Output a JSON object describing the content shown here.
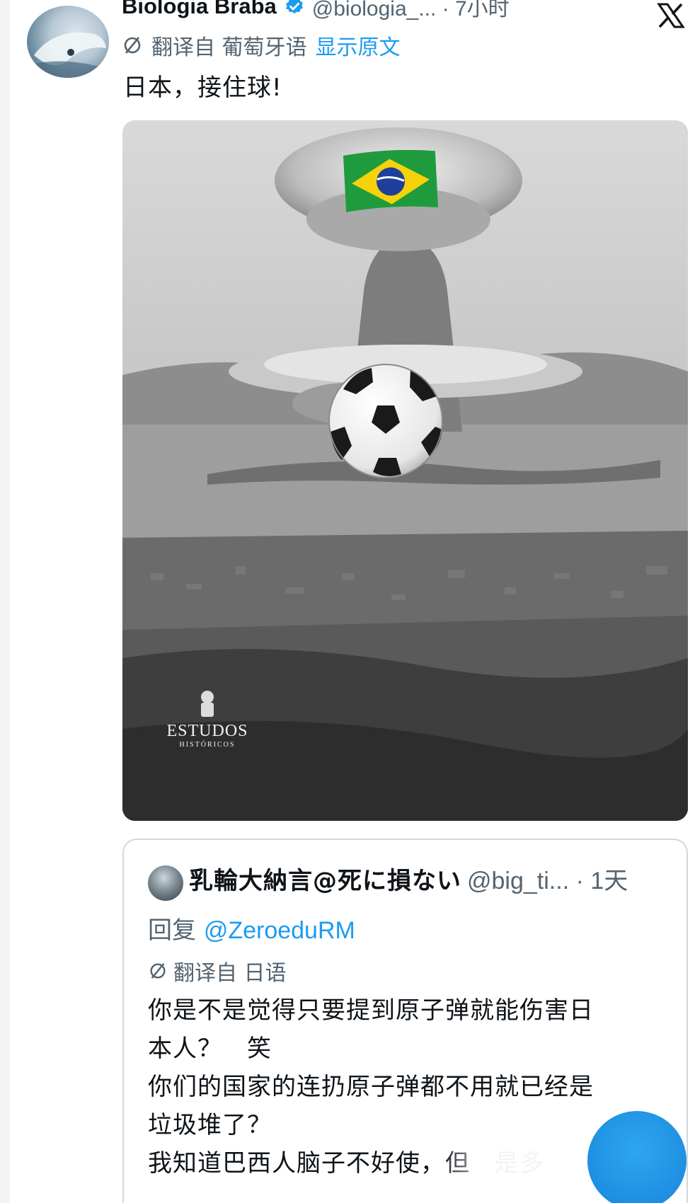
{
  "tweet": {
    "author_name": "Biologia Braba",
    "handle_time": "@biologia_... · 7小时",
    "translate_label": "翻译自 葡萄牙语",
    "show_original": "显示原文",
    "text": "日本，接住球!",
    "media": {
      "watermark_title": "ESTUDOS",
      "watermark_sub": "HISTÓRICOS"
    }
  },
  "quoted_tweet": {
    "author_name": "乳輪大納言@死に損ない",
    "handle_time": "@big_ti... · 1天",
    "reply_prefix": "回复 ",
    "reply_mention": "@ZeroeduRM",
    "translate_label": "翻译自 日语",
    "body_lines": [
      "你是不是觉得只要提到原子弹就能伤害日",
      "本人？　笑",
      "你们的国家的连扔原子弹都不用就已经是",
      "垃圾堆了？",
      "我知道巴西人脑子不好使，但　是多"
    ]
  },
  "icons": {
    "verified": "verified-badge-icon",
    "close": "x-logo-icon",
    "translate": "translate-icon"
  },
  "colors": {
    "link_blue": "#1d9bf0",
    "secondary_text": "#536471",
    "border": "#cfd9de"
  }
}
